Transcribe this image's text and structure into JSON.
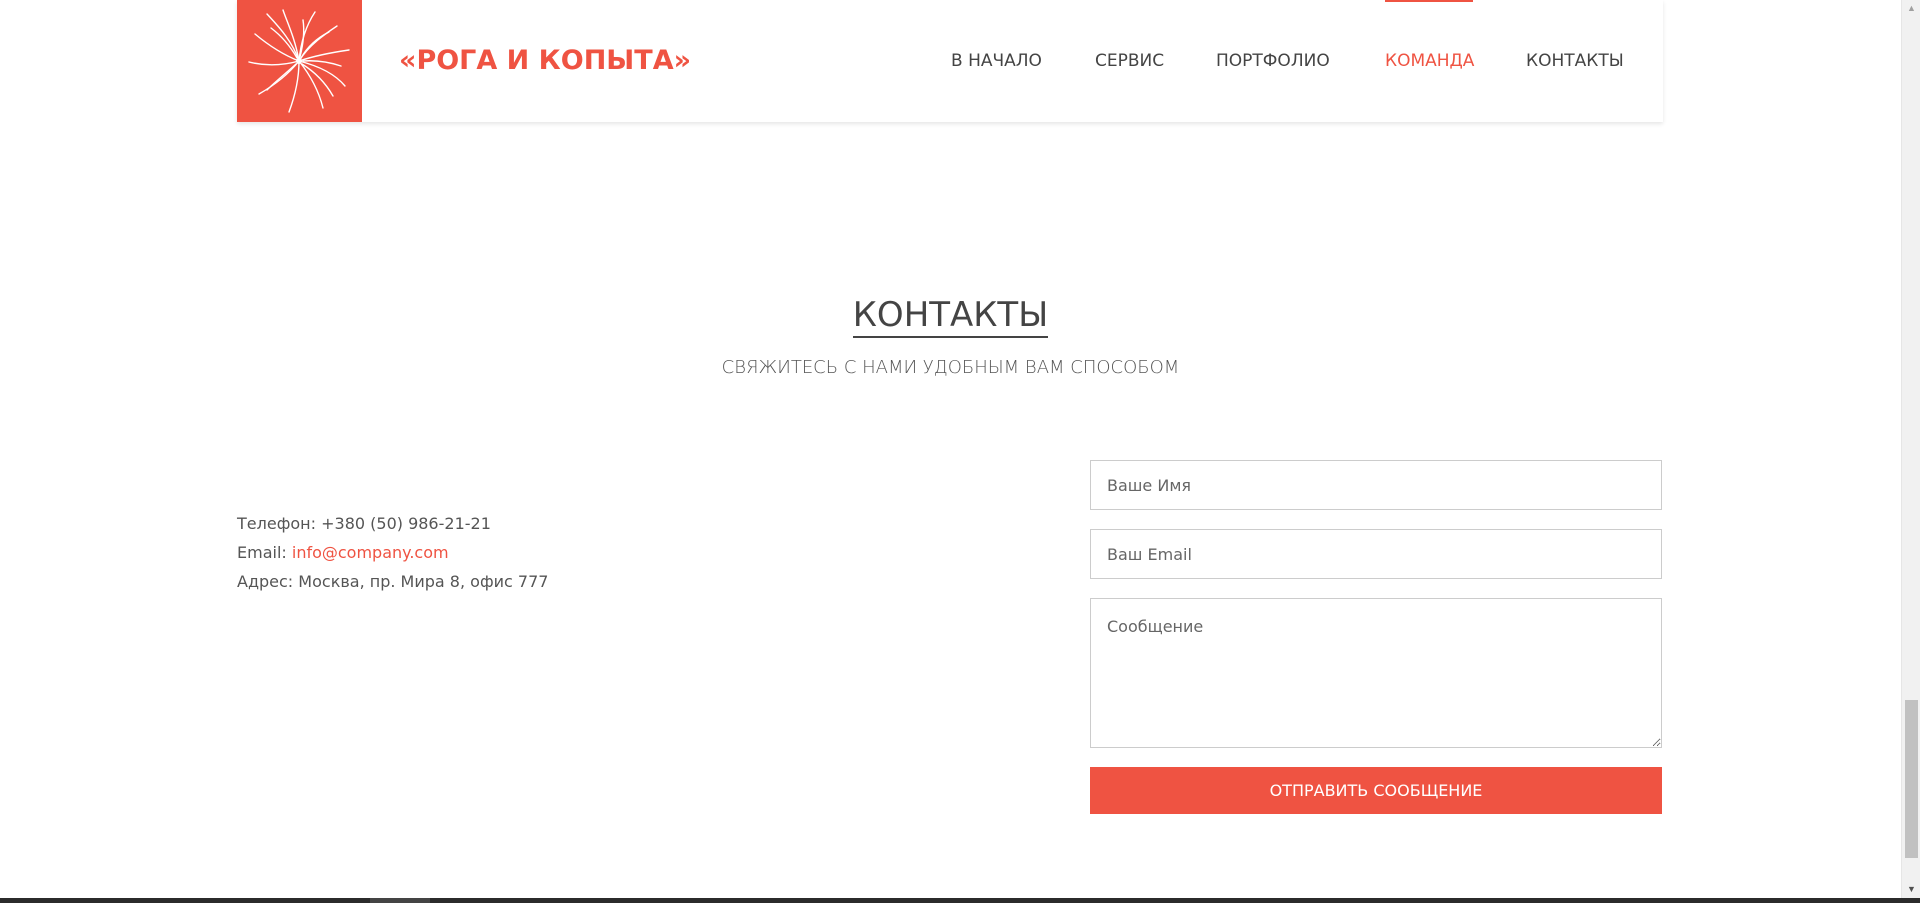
{
  "header": {
    "brand": "«РОГА И КОПЫТА»",
    "nav": [
      {
        "label": "В НАЧАЛО",
        "active": false
      },
      {
        "label": "СЕРВИС",
        "active": false
      },
      {
        "label": "ПОРТФОЛИО",
        "active": false
      },
      {
        "label": "КОМАНДА",
        "active": true
      },
      {
        "label": "КОНТАКТЫ",
        "active": false
      }
    ]
  },
  "contacts_section": {
    "title": "КОНТАКТЫ",
    "subtitle": "СВЯЖИТЕСЬ С НАМИ УДОБНЫМ ВАМ СПОСОБОМ",
    "phone_label": "Телефон:",
    "phone_value": "+380 (50) 986-21-21",
    "email_label": "Email:",
    "email_value": "info@company.com",
    "address_label": "Адрес:",
    "address_value": "Москва, пр. Мира 8, офис 777"
  },
  "form": {
    "name_placeholder": "Ваше Имя",
    "email_placeholder": "Ваш Email",
    "message_placeholder": "Сообщение",
    "submit_label": "ОТПРАВИТЬ СООБЩЕНИЕ"
  },
  "colors": {
    "accent": "#ef5342",
    "text": "#444444"
  },
  "icons": {
    "logo": "flower-burst-logo-icon",
    "scroll_up": "arrow-up-icon",
    "scroll_down": "arrow-down-icon"
  }
}
